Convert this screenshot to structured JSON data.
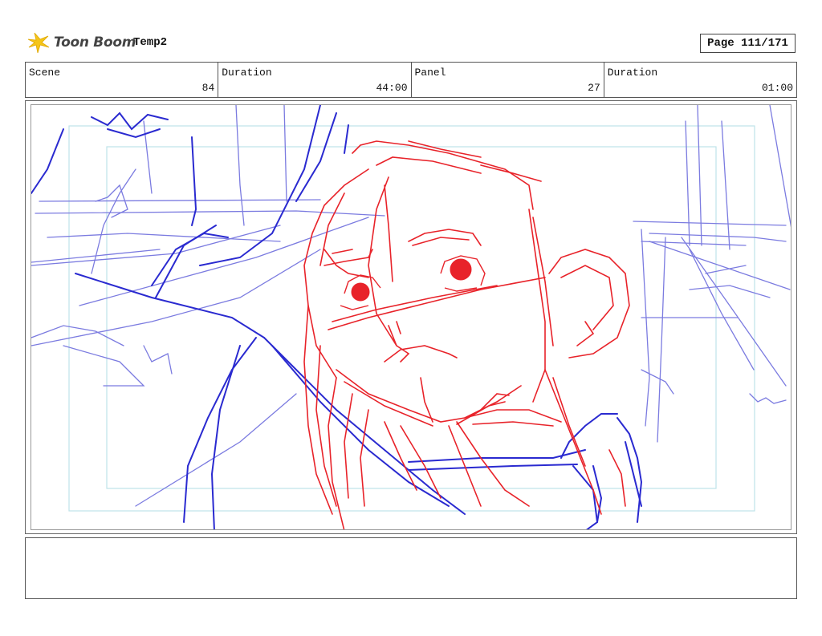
{
  "header": {
    "brand": "Toon Boom",
    "project": "Temp2",
    "page": "Page 111/171"
  },
  "info": [
    {
      "label": "Scene",
      "value": "84"
    },
    {
      "label": "Duration",
      "value": "44:00"
    },
    {
      "label": "Panel",
      "value": "27"
    },
    {
      "label": "Duration",
      "value": "01:00"
    }
  ],
  "colors": {
    "sketch_red": "#e8232a",
    "sketch_blue": "#2a2ad0",
    "sketch_light_blue": "#7b7be0",
    "safe_frame": "#bde3e8"
  },
  "notes": ""
}
